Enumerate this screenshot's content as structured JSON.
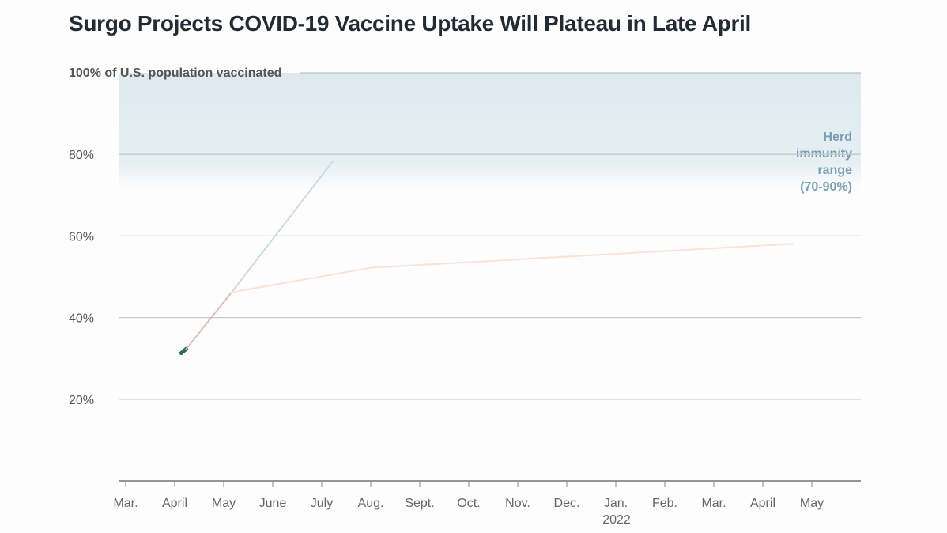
{
  "chart_data": {
    "type": "line",
    "title": "Surgo Projects COVID-19 Vaccine Uptake Will Plateau in Late April",
    "ylabel": "100% of U.S. population vaccinated",
    "ylim": [
      0,
      100
    ],
    "yticks": [
      20,
      40,
      60,
      80
    ],
    "ytick_labels": [
      "20%",
      "40%",
      "60%",
      "80%"
    ],
    "xlim": [
      "2021-03-01",
      "2022-06-15"
    ],
    "xticks": [
      "2021-03-01",
      "2021-04-01",
      "2021-05-01",
      "2021-06-01",
      "2021-07-01",
      "2021-08-01",
      "2021-09-01",
      "2021-10-01",
      "2021-11-01",
      "2021-12-01",
      "2022-01-01",
      "2022-02-01",
      "2022-03-01",
      "2022-04-01",
      "2022-05-01"
    ],
    "xtick_labels": [
      "Mar.",
      "April",
      "May",
      "June",
      "July",
      "Aug.",
      "Sept.",
      "Oct.",
      "Nov.",
      "Dec.",
      "Jan.",
      "Feb.",
      "Mar.",
      "April",
      "May"
    ],
    "x_year_label": "2022",
    "grid": true,
    "series": [
      {
        "color": "#2a6b6b",
        "style": "solid",
        "points": [
          [
            "2021-04-05",
            31.3
          ],
          [
            "2021-04-08",
            32.3
          ]
        ]
      },
      {
        "color": "#d9b8b0",
        "style": "dotted",
        "points": [
          [
            "2021-04-08",
            32.3
          ],
          [
            "2021-05-06",
            46.2
          ]
        ]
      },
      {
        "color": "#c9dbe3",
        "style": "solid",
        "points": [
          [
            "2021-05-06",
            46.2
          ],
          [
            "2021-07-08",
            78.3
          ]
        ]
      },
      {
        "color": "#fbe1d6",
        "style": "solid",
        "points": [
          [
            "2021-05-06",
            46.2
          ],
          [
            "2021-08-01",
            52.2
          ],
          [
            "2022-04-20",
            58.1
          ]
        ]
      }
    ],
    "band": {
      "range": [
        70,
        100
      ],
      "color": "#dde9ee",
      "label_lines": [
        "Herd",
        "immunity",
        "range",
        "(70-90%)"
      ]
    }
  }
}
